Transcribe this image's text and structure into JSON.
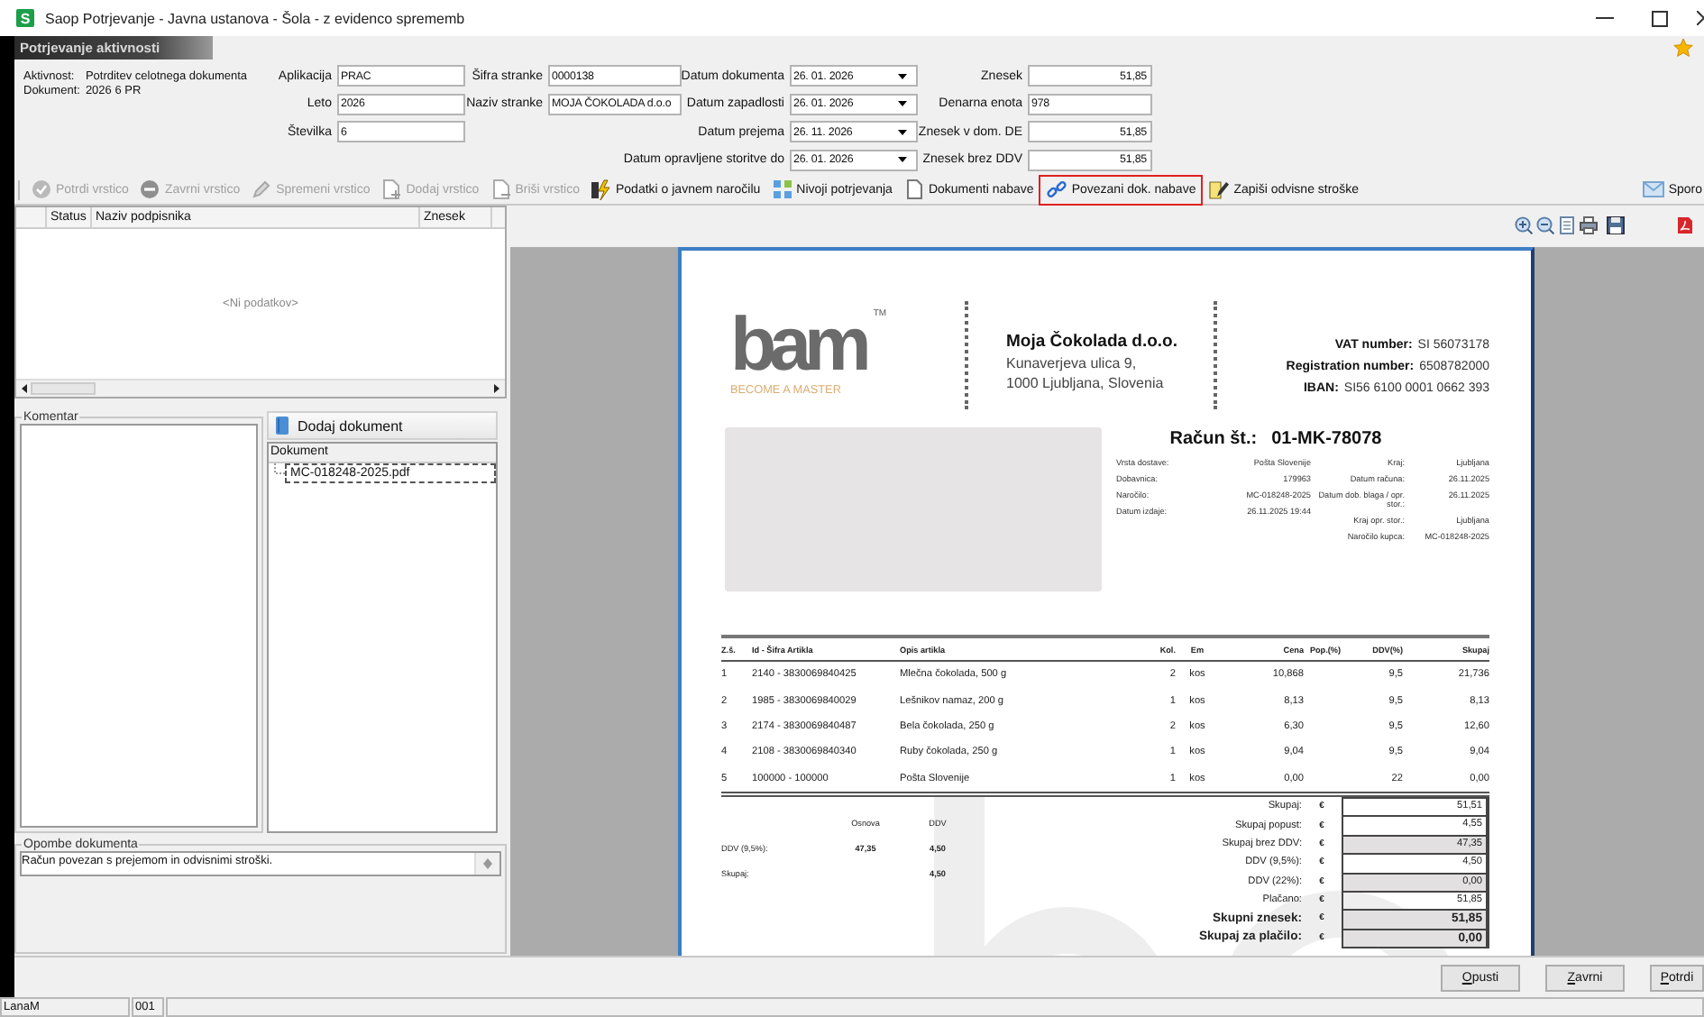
{
  "window": {
    "app_icon": "S",
    "title": "Saop Potrjevanje - Javna ustanova - Šola - z evidenco sprememb"
  },
  "panel_title": "Potrjevanje aktivnosti",
  "form": {
    "info": [
      {
        "label": "Aktivnost:",
        "value": "Potrditev celotnega dokumenta"
      },
      {
        "label": "Dokument:",
        "value": "2026 6 PR"
      }
    ],
    "columns": [
      [
        {
          "label": "Aplikacija",
          "value": "PRAC",
          "kind": "text"
        },
        {
          "label": "Leto",
          "value": "2026",
          "kind": "text"
        },
        {
          "label": "Številka",
          "value": "6",
          "kind": "text"
        }
      ],
      [
        {
          "label": "Šifra stranke",
          "value": "0000138",
          "kind": "text"
        },
        {
          "label": "Naziv stranke",
          "value": "MOJA ČOKOLADA d.o.o",
          "kind": "text"
        }
      ],
      [
        {
          "label": "Datum dokumenta",
          "value": "26. 01. 2026",
          "kind": "date"
        },
        {
          "label": "Datum zapadlosti",
          "value": "26. 01. 2026",
          "kind": "date"
        },
        {
          "label": "Datum prejema",
          "value": "26. 11. 2026",
          "kind": "date"
        },
        {
          "label": "Datum opravljene storitve do",
          "value": "26. 01. 2026",
          "kind": "date"
        }
      ],
      [
        {
          "label": "Znesek",
          "value": "51,85",
          "kind": "number"
        },
        {
          "label": "Denarna enota",
          "value": "978",
          "kind": "text"
        },
        {
          "label": "Znesek v dom. DE",
          "value": "51,85",
          "kind": "number"
        },
        {
          "label": "Znesek brez DDV",
          "value": "51,85",
          "kind": "number"
        }
      ]
    ]
  },
  "toolbar": [
    {
      "label": "Potrdi vrstico",
      "disabled": true,
      "highlighted": false
    },
    {
      "label": "Zavrni vrstico",
      "disabled": true,
      "highlighted": false
    },
    {
      "label": "Spremeni vrstico",
      "disabled": true,
      "highlighted": false
    },
    {
      "label": "Dodaj vrstico",
      "disabled": true,
      "highlighted": false
    },
    {
      "label": "Briši vrstico",
      "disabled": true,
      "highlighted": false
    },
    {
      "label": "Podatki o javnem naročilu",
      "disabled": false,
      "highlighted": false
    },
    {
      "label": "Nivoji potrjevanja",
      "disabled": false,
      "highlighted": false
    },
    {
      "label": "Dokumenti nabave",
      "disabled": false,
      "highlighted": false
    },
    {
      "label": "Povezani dok. nabave",
      "disabled": false,
      "highlighted": true
    },
    {
      "label": "Zapiši odvisne stroške",
      "disabled": false,
      "highlighted": false
    }
  ],
  "toolbar_right": {
    "label": "Sporo"
  },
  "signers_grid": {
    "columns": [
      "Status",
      "Naziv podpisnika",
      "Znesek"
    ],
    "empty_text": "<Ni podatkov>"
  },
  "comment": {
    "label": "Komentar"
  },
  "documents": {
    "add_button": "Dodaj dokument",
    "column": "Dokument",
    "files": [
      {
        "name": "MC-018248-2025.pdf",
        "selected": true
      }
    ]
  },
  "notes": {
    "label": "Opombe dokumenta",
    "value": "Račun povezan s prejemom in odvisnimi stroški."
  },
  "invoice": {
    "logo": {
      "wordmark": "bam",
      "trademark": "TM",
      "tagline": "BECOME A MASTER"
    },
    "company": {
      "name": "Moja Čokolada d.o.o.",
      "address": [
        "Kunaverjeva ulica 9,",
        "1000 Ljubljana, Slovenia"
      ]
    },
    "ids": [
      {
        "label": "VAT number:",
        "value": "SI 56073178"
      },
      {
        "label": "Registration number:",
        "value": "6508782000"
      },
      {
        "label": "IBAN:",
        "value": "SI56 6100 0001 0662 393"
      }
    ],
    "title": {
      "label": "Račun št.:",
      "number": "01-MK-78078"
    },
    "details_left": [
      {
        "label": "Vrsta dostave:",
        "value": "Pošta Slovenije"
      },
      {
        "label": "Dobavnica:",
        "value": "179963"
      },
      {
        "label": "Naročilo:",
        "value": "MC-018248-2025"
      },
      {
        "label": "Datum izdaje:",
        "value": "26.11.2025 19:44"
      }
    ],
    "details_right": [
      {
        "label": "Kraj:",
        "value": "Ljubljana"
      },
      {
        "label": "Datum računa:",
        "value": "26.11.2025"
      },
      {
        "label": "Datum dob. blaga / opr. stor.:",
        "value": "26.11.2025"
      },
      {
        "label": "Kraj opr. stor.:",
        "value": "Ljubljana"
      },
      {
        "label": "Naročilo kupca:",
        "value": "MC-018248-2025"
      }
    ],
    "columns": [
      "Z.š.",
      "Id - Šifra Artikla",
      "Opis artikla",
      "Kol.",
      "Em",
      "Cena",
      "Pop.(%)",
      "DDV(%)",
      "Skupaj"
    ],
    "rows": [
      {
        "no": "1",
        "code": "2140 - 3830069840425",
        "description": "Mlečna čokolada, 500 g",
        "qty": "2",
        "unit": "kos",
        "price": "10,868",
        "vat": "9,5",
        "total": "21,736"
      },
      {
        "no": "2",
        "code": "1985 - 3830069840029",
        "description": "Lešnikov namaz, 200 g",
        "qty": "1",
        "unit": "kos",
        "price": "8,13",
        "vat": "9,5",
        "total": "8,13"
      },
      {
        "no": "3",
        "code": "2174 - 3830069840487",
        "description": "Bela čokolada, 250 g",
        "qty": "2",
        "unit": "kos",
        "price": "6,30",
        "vat": "9,5",
        "total": "12,60"
      },
      {
        "no": "4",
        "code": "2108 - 3830069840340",
        "description": "Ruby čokolada, 250 g",
        "qty": "1",
        "unit": "kos",
        "price": "9,04",
        "vat": "9,5",
        "total": "9,04"
      },
      {
        "no": "5",
        "code": "100000 - 100000",
        "description": "Pošta Slovenije",
        "qty": "1",
        "unit": "kos",
        "price": "0,00",
        "vat": "22",
        "total": "0,00"
      }
    ],
    "tax_summary": {
      "columns": [
        "Osnova",
        "DDV"
      ],
      "rows": [
        {
          "label": "DDV (9,5%):",
          "base": "47,35",
          "vat": "4,50"
        },
        {
          "label": "Skupaj:",
          "vat": "4,50"
        }
      ]
    },
    "totals": [
      {
        "label": "Skupaj:",
        "currency": "€",
        "value": "51,51",
        "shaded": false,
        "bold": false
      },
      {
        "label": "Skupaj popust:",
        "currency": "€",
        "value": "4,55",
        "shaded": false,
        "bold": false
      },
      {
        "label": "Skupaj brez DDV:",
        "currency": "€",
        "value": "47,35",
        "shaded": true,
        "bold": false
      },
      {
        "label": "DDV (9,5%):",
        "currency": "€",
        "value": "4,50",
        "shaded": false,
        "bold": false
      },
      {
        "label": "DDV (22%):",
        "currency": "€",
        "value": "0,00",
        "shaded": true,
        "bold": false
      },
      {
        "label": "Plačano:",
        "currency": "€",
        "value": "51,85",
        "shaded": false,
        "bold": false
      },
      {
        "label": "Skupni znesek:",
        "currency": "€",
        "value": "51,85",
        "shaded": true,
        "bold": true
      },
      {
        "label": "Skupaj za plačilo:",
        "currency": "€",
        "value": "0,00",
        "shaded": true,
        "bold": true
      }
    ]
  },
  "buttons": [
    "Opusti",
    "Zavrni",
    "Potrdi"
  ],
  "status_bar": [
    "LanaM",
    "001"
  ]
}
